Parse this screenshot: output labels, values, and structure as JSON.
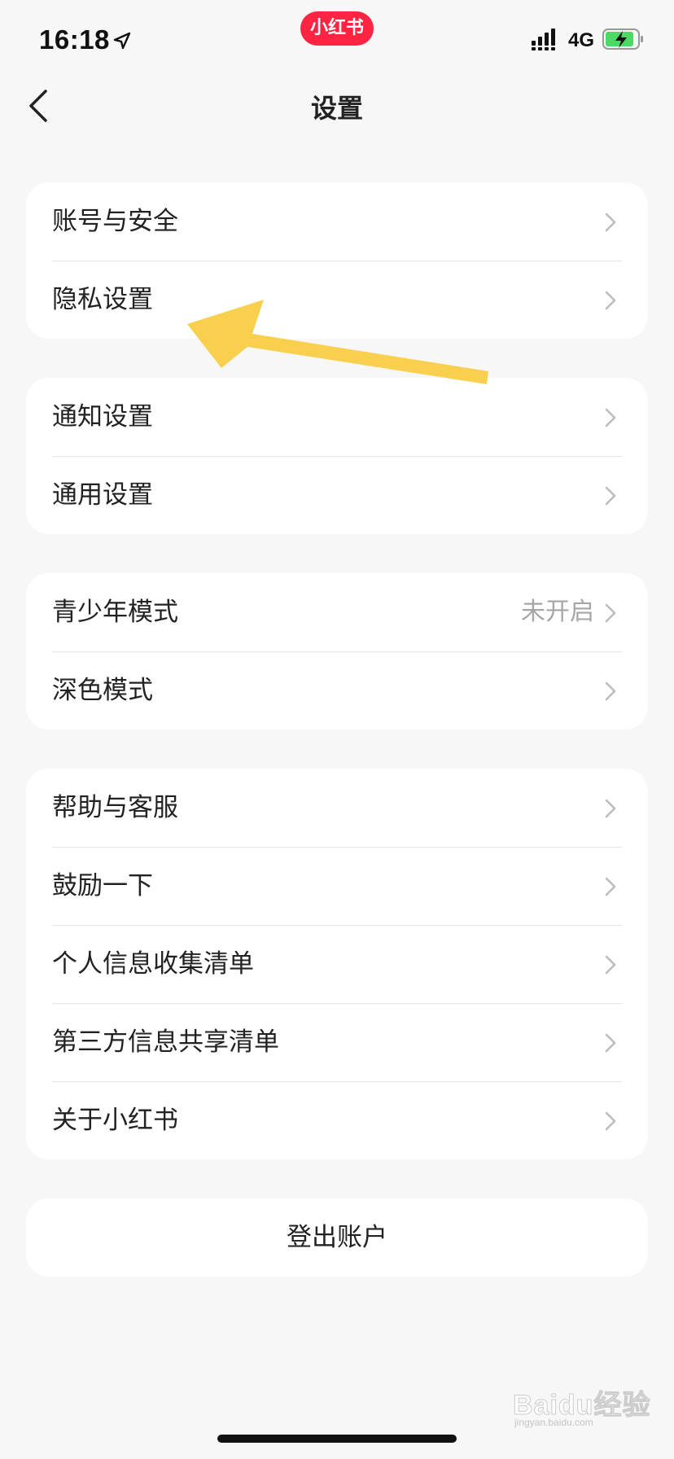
{
  "status_bar": {
    "time": "16:18",
    "app_badge": "小红书",
    "network": "4G",
    "icons": [
      "location-arrow-icon",
      "signal-bars-icon",
      "battery-charging-icon"
    ]
  },
  "header": {
    "title": "设置",
    "back_icon": "chevron-left-icon"
  },
  "groups": [
    {
      "items": [
        {
          "label": "账号与安全"
        },
        {
          "label": "隐私设置"
        }
      ]
    },
    {
      "items": [
        {
          "label": "通知设置"
        },
        {
          "label": "通用设置"
        }
      ]
    },
    {
      "items": [
        {
          "label": "青少年模式",
          "value": "未开启"
        },
        {
          "label": "深色模式"
        }
      ]
    },
    {
      "items": [
        {
          "label": "帮助与客服"
        },
        {
          "label": "鼓励一下"
        },
        {
          "label": "个人信息收集清单"
        },
        {
          "label": "第三方信息共享清单"
        },
        {
          "label": "关于小红书"
        }
      ]
    }
  ],
  "logout": {
    "label": "登出账户"
  },
  "annotation": {
    "arrow_color": "#f8d04e",
    "arrow_icon": "yellow-arrow-annotation"
  },
  "watermark": {
    "text": "Baidu经验",
    "sub": "jingyan.baidu.com"
  },
  "colors": {
    "background": "#f7f7f7",
    "card": "#ffffff",
    "brand": "#ff2442",
    "text": "#222222",
    "secondary_text": "#a6a6a6",
    "divider": "#e6e6e6"
  }
}
